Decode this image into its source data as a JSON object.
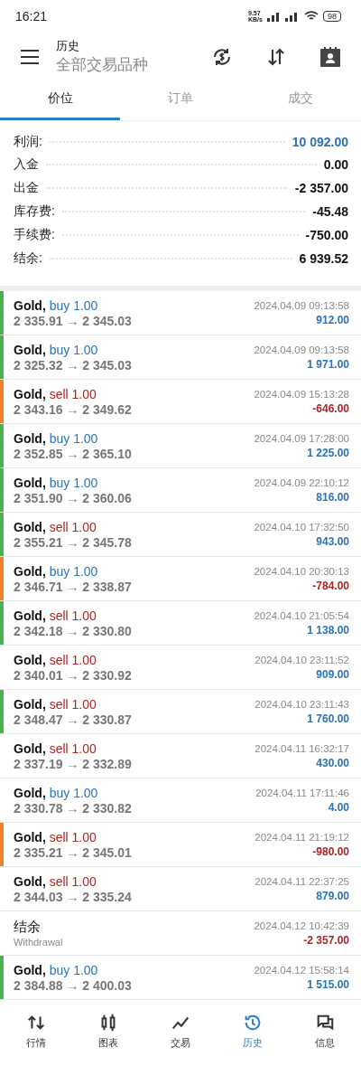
{
  "status_bar": {
    "time": "16:21",
    "speed": "9.57 KB/s",
    "battery": "98"
  },
  "header": {
    "title": "历史",
    "subtitle": "全部交易品种"
  },
  "tabs": [
    {
      "label": "价位",
      "selected": true
    },
    {
      "label": "订单",
      "selected": false
    },
    {
      "label": "成交",
      "selected": false
    }
  ],
  "summary": [
    {
      "label": "利润:",
      "value": "10 092.00",
      "highlight": true
    },
    {
      "label": "入金",
      "value": "0.00",
      "highlight": false
    },
    {
      "label": "出金",
      "value": "-2 357.00",
      "highlight": false
    },
    {
      "label": "库存费:",
      "value": "-45.48",
      "highlight": false
    },
    {
      "label": "手续费:",
      "value": "-750.00",
      "highlight": false
    },
    {
      "label": "结余:",
      "value": "6 939.52",
      "highlight": false
    }
  ],
  "deals": [
    {
      "kind": "trade",
      "symbol": "Gold,",
      "side": "buy",
      "is_sell": false,
      "volume": "1.00",
      "prices": "2 335.91 → 2 345.03",
      "time": "2024.04.09 09:13:58",
      "profit": "912.00",
      "negative": false,
      "color": "#4caf50"
    },
    {
      "kind": "trade",
      "symbol": "Gold,",
      "side": "buy",
      "is_sell": false,
      "volume": "1.00",
      "prices": "2 325.32 → 2 345.03",
      "time": "2024.04.09 09:13:58",
      "profit": "1 971.00",
      "negative": false,
      "color": "#4caf50"
    },
    {
      "kind": "trade",
      "symbol": "Gold,",
      "side": "sell",
      "is_sell": true,
      "volume": "1.00",
      "prices": "2 343.16 → 2 349.62",
      "time": "2024.04.09 15:13:28",
      "profit": "-646.00",
      "negative": true,
      "color": "#f0802a"
    },
    {
      "kind": "trade",
      "symbol": "Gold,",
      "side": "buy",
      "is_sell": false,
      "volume": "1.00",
      "prices": "2 352.85 → 2 365.10",
      "time": "2024.04.09 17:28:00",
      "profit": "1 225.00",
      "negative": false,
      "color": "#4caf50"
    },
    {
      "kind": "trade",
      "symbol": "Gold,",
      "side": "buy",
      "is_sell": false,
      "volume": "1.00",
      "prices": "2 351.90 → 2 360.06",
      "time": "2024.04.09 22:10:12",
      "profit": "816.00",
      "negative": false,
      "color": "#4caf50"
    },
    {
      "kind": "trade",
      "symbol": "Gold,",
      "side": "sell",
      "is_sell": true,
      "volume": "1.00",
      "prices": "2 355.21 → 2 345.78",
      "time": "2024.04.10 17:32:50",
      "profit": "943.00",
      "negative": false,
      "color": "#4caf50"
    },
    {
      "kind": "trade",
      "symbol": "Gold,",
      "side": "buy",
      "is_sell": false,
      "volume": "1.00",
      "prices": "2 346.71 → 2 338.87",
      "time": "2024.04.10 20:30:13",
      "profit": "-784.00",
      "negative": true,
      "color": "#f0802a"
    },
    {
      "kind": "trade",
      "symbol": "Gold,",
      "side": "sell",
      "is_sell": true,
      "volume": "1.00",
      "prices": "2 342.18 → 2 330.80",
      "time": "2024.04.10 21:05:54",
      "profit": "1 138.00",
      "negative": false,
      "color": "#4caf50"
    },
    {
      "kind": "trade",
      "symbol": "Gold,",
      "side": "sell",
      "is_sell": true,
      "volume": "1.00",
      "prices": "2 340.01 → 2 330.92",
      "time": "2024.04.10 23:11:52",
      "profit": "909.00",
      "negative": false
    },
    {
      "kind": "trade",
      "symbol": "Gold,",
      "side": "sell",
      "is_sell": true,
      "volume": "1.00",
      "prices": "2 348.47 → 2 330.87",
      "time": "2024.04.10 23:11:43",
      "profit": "1 760.00",
      "negative": false,
      "color": "#4caf50"
    },
    {
      "kind": "trade",
      "symbol": "Gold,",
      "side": "sell",
      "is_sell": true,
      "volume": "1.00",
      "prices": "2 337.19 → 2 332.89",
      "time": "2024.04.11 16:32:17",
      "profit": "430.00",
      "negative": false
    },
    {
      "kind": "trade",
      "symbol": "Gold,",
      "side": "buy",
      "is_sell": false,
      "volume": "1.00",
      "prices": "2 330.78 → 2 330.82",
      "time": "2024.04.11 17:11:46",
      "profit": "4.00",
      "negative": false
    },
    {
      "kind": "trade",
      "symbol": "Gold,",
      "side": "sell",
      "is_sell": true,
      "volume": "1.00",
      "prices": "2 335.21 → 2 345.01",
      "time": "2024.04.11 21:19:12",
      "profit": "-980.00",
      "negative": true,
      "color": "#f0802a"
    },
    {
      "kind": "trade",
      "symbol": "Gold,",
      "side": "sell",
      "is_sell": true,
      "volume": "1.00",
      "prices": "2 344.03 → 2 335.24",
      "time": "2024.04.11 22:37:25",
      "profit": "879.00",
      "negative": false
    },
    {
      "kind": "balance",
      "title": "结余",
      "comment": "Withdrawal",
      "time": "2024.04.12 10:42:39",
      "profit": "-2 357.00",
      "negative": true
    },
    {
      "kind": "trade",
      "symbol": "Gold,",
      "side": "buy",
      "is_sell": false,
      "volume": "1.00",
      "prices": "2 384.88 → 2 400.03",
      "time": "2024.04.12 15:58:14",
      "profit": "1 515.00",
      "negative": false,
      "color": "#4caf50"
    }
  ],
  "nav": [
    {
      "kind": "quotes",
      "label": "行情",
      "selected": false
    },
    {
      "kind": "chart",
      "label": "图表",
      "selected": false
    },
    {
      "kind": "trade",
      "label": "交易",
      "selected": false
    },
    {
      "kind": "history",
      "label": "历史",
      "selected": true
    },
    {
      "kind": "messages",
      "label": "信息",
      "selected": false
    }
  ]
}
